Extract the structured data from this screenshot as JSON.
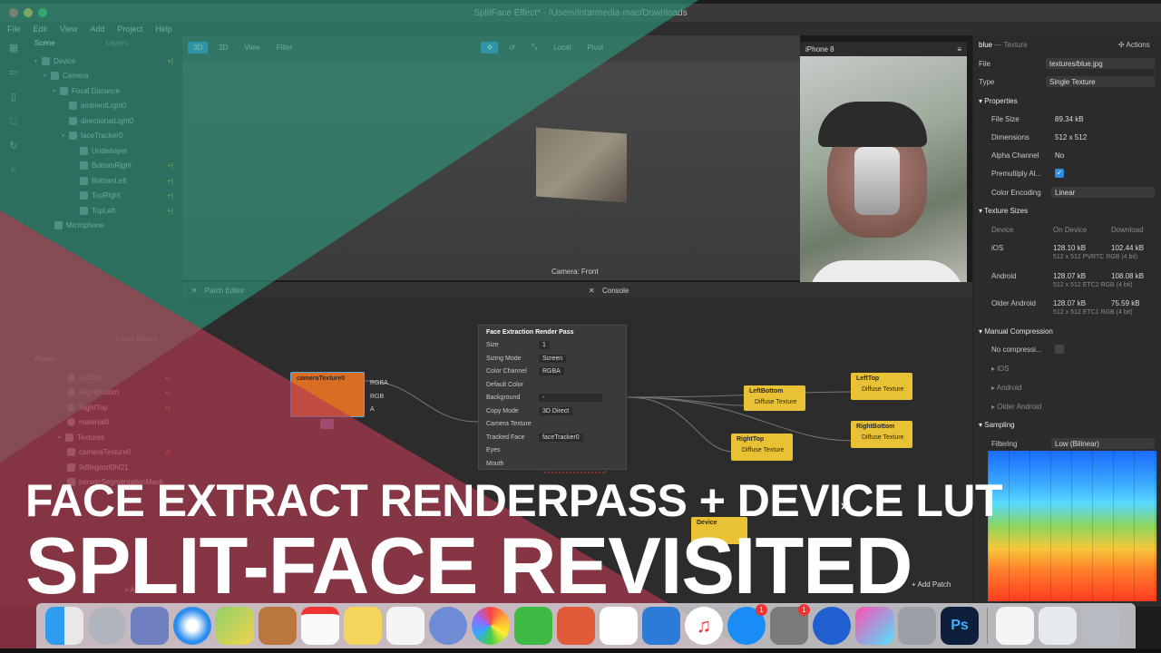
{
  "window": {
    "title": "SplitFace Effect* - /Users/intarmedia-mac/Downloads"
  },
  "menu": [
    "File",
    "Edit",
    "View",
    "Add",
    "Project",
    "Help"
  ],
  "scene": {
    "tabs": [
      "Scene",
      "Layers"
    ],
    "tree": [
      {
        "label": "Device",
        "indent": 1
      },
      {
        "label": "Camera",
        "indent": 2
      },
      {
        "label": "Focal Distance",
        "indent": 3
      },
      {
        "label": "ambientLight0",
        "indent": 4
      },
      {
        "label": "directionalLight0",
        "indent": 4
      },
      {
        "label": "faceTracker0",
        "indent": 4
      },
      {
        "label": "Underlayer",
        "indent": 5
      },
      {
        "label": "BottomRight",
        "indent": 5
      },
      {
        "label": "BottomLeft",
        "indent": 5
      },
      {
        "label": "TopRight",
        "indent": 5
      },
      {
        "label": "TopLeft",
        "indent": 5
      },
      {
        "label": "Microphone",
        "indent": 2
      }
    ],
    "add_object": "+ Add Object",
    "assets_title": "Assets",
    "assets": [
      "LeftTop",
      "RightBottom",
      "RightTop",
      "material0",
      "Textures",
      "cameraTexture0",
      "9d9ngmzl0hf21",
      "personSegmentationMask"
    ],
    "add_asset": "+ Add Asset"
  },
  "viewport": {
    "toolbar": [
      "3D",
      "2D",
      "View",
      "Filter"
    ],
    "center_tools": [
      "Local",
      "Pivot"
    ],
    "caption": "Camera: Front"
  },
  "device": {
    "model": "iPhone 8"
  },
  "patch": {
    "tabs": [
      "Patch Editor",
      "Console"
    ],
    "camera_node": {
      "title": "cameraTexture0",
      "ports": [
        "RGBA",
        "RGB",
        "A"
      ]
    },
    "render_pass": {
      "title": "Face Extraction Render Pass",
      "rows": [
        {
          "label": "Size",
          "value": "1"
        },
        {
          "label": "Sizing Mode",
          "value": "Screen"
        },
        {
          "label": "Color Channel",
          "value": "RGBA"
        },
        {
          "label": "Default Color",
          "value": ""
        },
        {
          "label": "Background",
          "value": "-"
        },
        {
          "label": "Copy Mode",
          "value": "3D Direct"
        },
        {
          "label": "Camera Texture",
          "value": ""
        },
        {
          "label": "Tracked Face",
          "value": "faceTracker0"
        },
        {
          "label": "Eyes",
          "value": ""
        },
        {
          "label": "Mouth",
          "value": ""
        }
      ]
    },
    "nodes": [
      {
        "title": "LeftBottom",
        "port": "Diffuse Texture"
      },
      {
        "title": "LeftTop",
        "port": "Diffuse Texture"
      },
      {
        "title": "RightTop",
        "port": "Diffuse Texture"
      },
      {
        "title": "RightBottom",
        "port": "Diffuse Texture"
      },
      {
        "title": "Device",
        "port": ""
      }
    ],
    "add_patch": "+ Add Patch"
  },
  "properties": {
    "name": "blue",
    "kind": "Texture",
    "actions": "Actions",
    "file_label": "File",
    "file_value": "textures/blue.jpg",
    "type_label": "Type",
    "type_value": "Single Texture",
    "properties_title": "Properties",
    "file_size_label": "File Size",
    "file_size": "89.34 kB",
    "dimensions_label": "Dimensions",
    "dimensions": "512 x 512",
    "alpha_label": "Alpha Channel",
    "alpha": "No",
    "premult_label": "Premultiply Al...",
    "color_enc_label": "Color Encoding",
    "color_enc": "Linear",
    "texture_sizes_title": "Texture Sizes",
    "sizes_headers": [
      "Device",
      "On Device",
      "Download"
    ],
    "sizes": [
      {
        "device": "iOS",
        "on_device": "128.10 kB",
        "download": "102.44 kB",
        "detail": "512 x 512 PVRTC RGB (4 bit)"
      },
      {
        "device": "Android",
        "on_device": "128.07 kB",
        "download": "108.08 kB",
        "detail": "512 x 512 ETC2 RGB (4 bit)"
      },
      {
        "device": "Older Android",
        "on_device": "128.07 kB",
        "download": "75.59 kB",
        "detail": "512 x 512 ETC1 RGB (4 bit)"
      }
    ],
    "manual_comp_title": "Manual Compression",
    "no_comp": "No compressi...",
    "manual_items": [
      "iOS",
      "Android",
      "Older Android"
    ],
    "sampling_title": "Sampling",
    "filtering_label": "Filtering",
    "filtering": "Low (Bilinear)"
  },
  "headline": {
    "line1": "FACE EXTRACT RENDERPASS + DEVICE LUT",
    "line2": "SPLIT-FACE REVISITED"
  },
  "dock": {
    "badge_counts": [
      "1",
      "1"
    ]
  },
  "colors": {
    "overlay_green": "#2e9a7e",
    "overlay_red": "#b3394f",
    "accent_blue": "#2d8ce6",
    "node_yellow": "#e8c234",
    "node_orange": "#d96d24"
  }
}
